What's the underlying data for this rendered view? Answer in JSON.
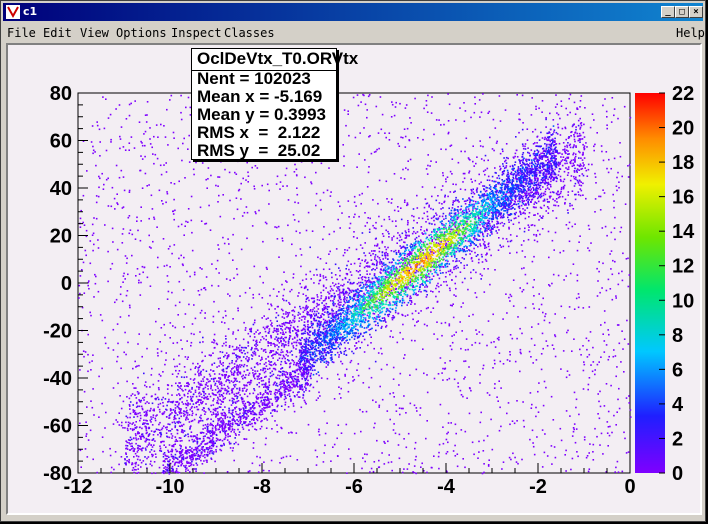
{
  "window": {
    "title": "c1",
    "min_label": "_",
    "max_label": "□",
    "close_label": "×"
  },
  "menu": {
    "items": [
      "File",
      "Edit",
      "View",
      "Options",
      "Inspect",
      "Classes"
    ],
    "help": "Help"
  },
  "stats": {
    "name": "OclDeVtx_T0.ORVtx",
    "lines": [
      "Nent = 102023",
      "Mean x = -5.169",
      "Mean y = 0.3993",
      "RMS x  =  2.122",
      "RMS y  =  25.02"
    ]
  },
  "chart_data": {
    "type": "heatmap",
    "xlim": [
      -12,
      0
    ],
    "ylim": [
      -80,
      80
    ],
    "x_ticks": [
      "-12",
      "-10",
      "-8",
      "-6",
      "-4",
      "-2",
      "0"
    ],
    "y_ticks": [
      "80",
      "60",
      "40",
      "20",
      "0",
      "-20",
      "-40",
      "-60",
      "-80"
    ],
    "z_range": [
      0,
      22
    ],
    "z_ticks": [
      "22",
      "20",
      "18",
      "16",
      "14",
      "12",
      "10",
      "8",
      "6",
      "4",
      "2",
      "0"
    ],
    "entries": 102023,
    "mean_x": -5.169,
    "mean_y": 0.3993,
    "rms_x": 2.122,
    "rms_y": 25.02,
    "palette": "rainbow (violet to red)",
    "colors": {
      "background": "#f3eef3",
      "low": "#7f00ff",
      "high": "#ff0000"
    }
  }
}
